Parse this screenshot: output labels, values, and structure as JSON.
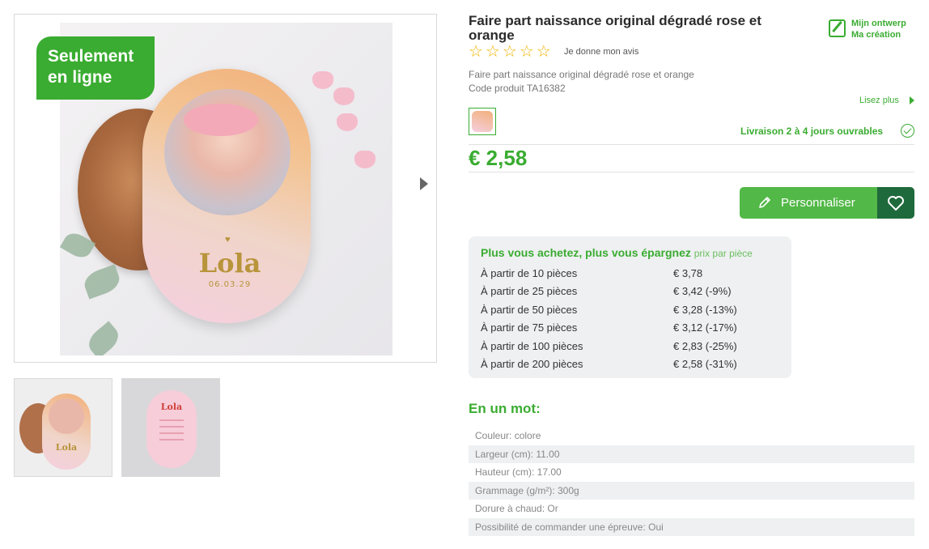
{
  "gallery": {
    "badge_line1": "Seulement",
    "badge_line2": "en ligne",
    "card_name": "Lola",
    "card_date": "06.03.29",
    "thumb1_name": "Lola",
    "thumb2_name": "Lola"
  },
  "product": {
    "title": "Faire part naissance original dégradé rose et orange",
    "my_design_line1": "Mijn ontwerp",
    "my_design_line2": "Ma création",
    "rating_stars": 5,
    "rating_filled": 0,
    "review_link": "Je donne mon avis",
    "description": "Faire part naissance original dégradé rose et orange",
    "product_code": "Code produit TA16382",
    "read_more": "Lisez plus",
    "delivery": "Livraison 2 à 4 jours ouvrables",
    "price": "€ 2,58",
    "personalize_label": "Personnaliser"
  },
  "pricing": {
    "heading": "Plus vous achetez, plus vous épargnez",
    "subheading": "prix par pièce",
    "tiers": [
      {
        "qty": "À partir de 10 pièces",
        "price": "€ 3,78"
      },
      {
        "qty": "À partir de 25 pièces",
        "price": "€ 3,42 (-9%)"
      },
      {
        "qty": "À partir de 50 pièces",
        "price": "€ 3,28 (-13%)"
      },
      {
        "qty": "À partir de 75 pièces",
        "price": "€ 3,12 (-17%)"
      },
      {
        "qty": "À partir de 100 pièces",
        "price": "€ 2,83 (-25%)"
      },
      {
        "qty": "À partir de 200 pièces",
        "price": "€ 2,58 (-31%)"
      }
    ]
  },
  "specs": {
    "title": "En un mot:",
    "rows": [
      "Couleur: colore",
      "Largeur (cm): 11.00",
      "Hauteur (cm): 17.00",
      "Grammage (g/m²): 300g",
      "Dorure à chaud: Or",
      "Possibilité de commander une épreuve: Oui"
    ]
  },
  "colors": {
    "accent": "#3aac31",
    "button": "#52b847",
    "wishlist": "#1f6a3c",
    "star": "#f0b400"
  }
}
